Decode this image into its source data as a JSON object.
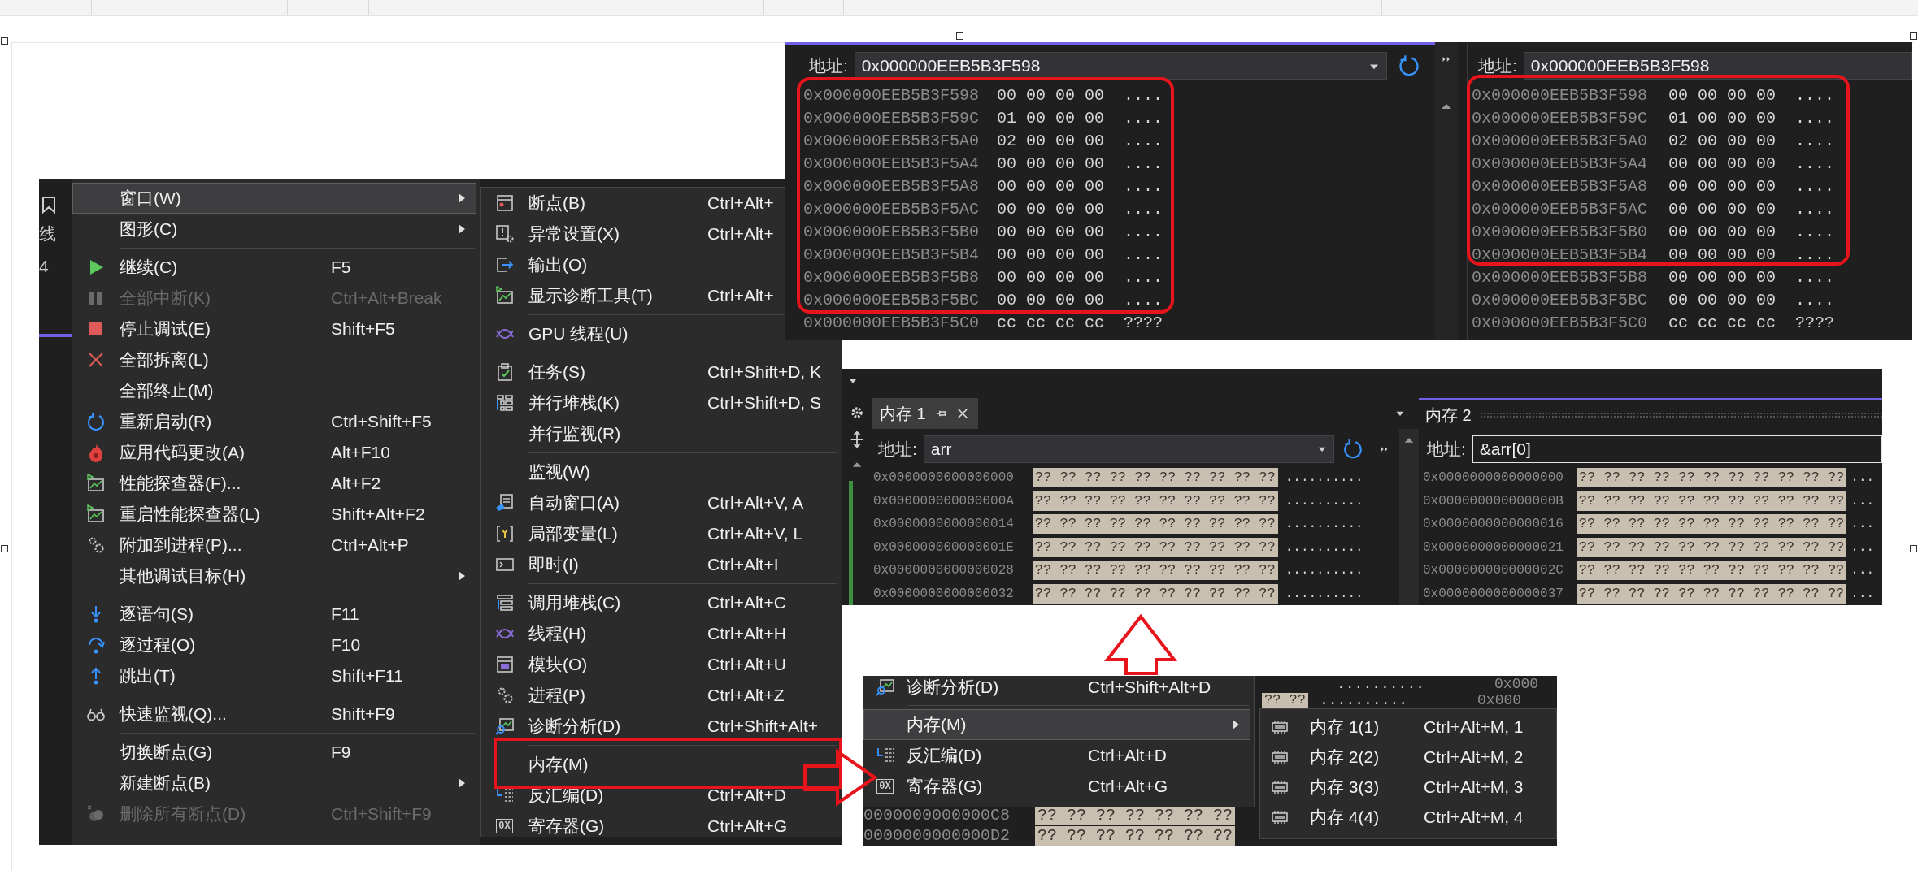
{
  "debug_menu": {
    "ide_edge": [
      "线",
      "4"
    ],
    "items": [
      {
        "kind": "item",
        "label": "窗口(W)",
        "selected": true,
        "disabled": false,
        "submenu": true
      },
      {
        "kind": "item",
        "label": "图形(C)",
        "selected": false,
        "disabled": false,
        "submenu": true
      },
      {
        "kind": "separator"
      },
      {
        "kind": "item",
        "label": "继续(C)",
        "shortcut": "F5",
        "selected": false,
        "disabled": false,
        "submenu": false
      },
      {
        "kind": "item",
        "label": "全部中断(K)",
        "shortcut": "Ctrl+Alt+Break",
        "selected": false,
        "disabled": true,
        "submenu": false
      },
      {
        "kind": "item",
        "label": "停止调试(E)",
        "shortcut": "Shift+F5",
        "selected": false,
        "disabled": false,
        "submenu": false
      },
      {
        "kind": "item",
        "label": "全部拆离(L)",
        "selected": false,
        "disabled": false,
        "submenu": false
      },
      {
        "kind": "item",
        "label": "全部终止(M)",
        "selected": false,
        "disabled": false,
        "submenu": false
      },
      {
        "kind": "item",
        "label": "重新启动(R)",
        "shortcut": "Ctrl+Shift+F5",
        "selected": false,
        "disabled": false,
        "submenu": false
      },
      {
        "kind": "item",
        "label": "应用代码更改(A)",
        "shortcut": "Alt+F10",
        "selected": false,
        "disabled": false,
        "submenu": false
      },
      {
        "kind": "item",
        "label": "性能探查器(F)...",
        "shortcut": "Alt+F2",
        "selected": false,
        "disabled": false,
        "submenu": false
      },
      {
        "kind": "item",
        "label": "重启性能探查器(L)",
        "shortcut": "Shift+Alt+F2",
        "selected": false,
        "disabled": false,
        "submenu": false
      },
      {
        "kind": "item",
        "label": "附加到进程(P)...",
        "shortcut": "Ctrl+Alt+P",
        "selected": false,
        "disabled": false,
        "submenu": false
      },
      {
        "kind": "item",
        "label": "其他调试目标(H)",
        "selected": false,
        "disabled": false,
        "submenu": true
      },
      {
        "kind": "separator"
      },
      {
        "kind": "item",
        "label": "逐语句(S)",
        "shortcut": "F11",
        "selected": false,
        "disabled": false,
        "submenu": false
      },
      {
        "kind": "item",
        "label": "逐过程(O)",
        "shortcut": "F10",
        "selected": false,
        "disabled": false,
        "submenu": false
      },
      {
        "kind": "item",
        "label": "跳出(T)",
        "shortcut": "Shift+F11",
        "selected": false,
        "disabled": false,
        "submenu": false
      },
      {
        "kind": "separator"
      },
      {
        "kind": "item",
        "label": "快速监视(Q)...",
        "shortcut": "Shift+F9",
        "selected": false,
        "disabled": false,
        "submenu": false
      },
      {
        "kind": "separator"
      },
      {
        "kind": "item",
        "label": "切换断点(G)",
        "shortcut": "F9",
        "selected": false,
        "disabled": false,
        "submenu": false
      },
      {
        "kind": "item",
        "label": "新建断点(B)",
        "selected": false,
        "disabled": false,
        "submenu": true
      },
      {
        "kind": "item",
        "label": "删除所有断点(D)",
        "shortcut": "Ctrl+Shift+F9",
        "selected": false,
        "disabled": true,
        "submenu": false
      },
      {
        "kind": "separator"
      }
    ]
  },
  "window_submenu": {
    "items": [
      {
        "kind": "item",
        "label": "断点(B)",
        "shortcut": "Ctrl+Alt+"
      },
      {
        "kind": "item",
        "label": "异常设置(X)",
        "shortcut": "Ctrl+Alt+"
      },
      {
        "kind": "item",
        "label": "输出(O)"
      },
      {
        "kind": "item",
        "label": "显示诊断工具(T)",
        "shortcut": "Ctrl+Alt+"
      },
      {
        "kind": "separator"
      },
      {
        "kind": "item",
        "label": "GPU 线程(U)"
      },
      {
        "kind": "separator"
      },
      {
        "kind": "item",
        "label": "任务(S)",
        "shortcut": "Ctrl+Shift+D, K"
      },
      {
        "kind": "item",
        "label": "并行堆栈(K)",
        "shortcut": "Ctrl+Shift+D, S"
      },
      {
        "kind": "item",
        "label": "并行监视(R)"
      },
      {
        "kind": "separator"
      },
      {
        "kind": "item",
        "label": "监视(W)"
      },
      {
        "kind": "item",
        "label": "自动窗口(A)",
        "shortcut": "Ctrl+Alt+V, A"
      },
      {
        "kind": "item",
        "label": "局部变量(L)",
        "shortcut": "Ctrl+Alt+V, L"
      },
      {
        "kind": "item",
        "label": "即时(I)",
        "shortcut": "Ctrl+Alt+I"
      },
      {
        "kind": "separator"
      },
      {
        "kind": "item",
        "label": "调用堆栈(C)",
        "shortcut": "Ctrl+Alt+C"
      },
      {
        "kind": "item",
        "label": "线程(H)",
        "shortcut": "Ctrl+Alt+H"
      },
      {
        "kind": "item",
        "label": "模块(O)",
        "shortcut": "Ctrl+Alt+U"
      },
      {
        "kind": "item",
        "label": "进程(P)",
        "shortcut": "Ctrl+Alt+Z"
      },
      {
        "kind": "item",
        "label": "诊断分析(D)",
        "shortcut": "Ctrl+Shift+Alt+"
      },
      {
        "kind": "separator"
      },
      {
        "kind": "item",
        "label": "内存(M)"
      },
      {
        "kind": "item",
        "label": "反汇编(D)",
        "shortcut": "Ctrl+Alt+D"
      },
      {
        "kind": "item",
        "label": "寄存器(G)",
        "shortcut": "Ctrl+Alt+G",
        "badge": "0X"
      }
    ]
  },
  "memory_window_top": {
    "panes": [
      {
        "active": true,
        "address_label": "地址:",
        "address": "0x000000EEB5B3F598",
        "rows": [
          {
            "address": "0x000000EEB5B3F598",
            "bytes": "00 00 00 00",
            "chars": "...."
          },
          {
            "address": "0x000000EEB5B3F59C",
            "bytes": "01 00 00 00",
            "chars": "...."
          },
          {
            "address": "0x000000EEB5B3F5A0",
            "bytes": "02 00 00 00",
            "chars": "...."
          },
          {
            "address": "0x000000EEB5B3F5A4",
            "bytes": "00 00 00 00",
            "chars": "...."
          },
          {
            "address": "0x000000EEB5B3F5A8",
            "bytes": "00 00 00 00",
            "chars": "...."
          },
          {
            "address": "0x000000EEB5B3F5AC",
            "bytes": "00 00 00 00",
            "chars": "...."
          },
          {
            "address": "0x000000EEB5B3F5B0",
            "bytes": "00 00 00 00",
            "chars": "...."
          },
          {
            "address": "0x000000EEB5B3F5B4",
            "bytes": "00 00 00 00",
            "chars": "...."
          },
          {
            "address": "0x000000EEB5B3F5B8",
            "bytes": "00 00 00 00",
            "chars": "...."
          },
          {
            "address": "0x000000EEB5B3F5BC",
            "bytes": "00 00 00 00",
            "chars": "...."
          },
          {
            "address": "0x000000EEB5B3F5C0",
            "bytes": "cc cc cc cc",
            "chars": "????"
          }
        ]
      },
      {
        "active": false,
        "address_label": "地址:",
        "address": "0x000000EEB5B3F598",
        "rows": [
          {
            "address": "0x000000EEB5B3F598",
            "bytes": "00 00 00 00",
            "chars": "...."
          },
          {
            "address": "0x000000EEB5B3F59C",
            "bytes": "01 00 00 00",
            "chars": "...."
          },
          {
            "address": "0x000000EEB5B3F5A0",
            "bytes": "02 00 00 00",
            "chars": "...."
          },
          {
            "address": "0x000000EEB5B3F5A4",
            "bytes": "00 00 00 00",
            "chars": "...."
          },
          {
            "address": "0x000000EEB5B3F5A8",
            "bytes": "00 00 00 00",
            "chars": "...."
          },
          {
            "address": "0x000000EEB5B3F5AC",
            "bytes": "00 00 00 00",
            "chars": "...."
          },
          {
            "address": "0x000000EEB5B3F5B0",
            "bytes": "00 00 00 00",
            "chars": "...."
          },
          {
            "address": "0x000000EEB5B3F5B4",
            "bytes": "00 00 00 00",
            "chars": "...."
          },
          {
            "address": "0x000000EEB5B3F5B8",
            "bytes": "00 00 00 00",
            "chars": "...."
          },
          {
            "address": "0x000000EEB5B3F5BC",
            "bytes": "00 00 00 00",
            "chars": "...."
          },
          {
            "address": "0x000000EEB5B3F5C0",
            "bytes": "cc cc cc cc",
            "chars": "????"
          }
        ]
      }
    ]
  },
  "memory_window_bottom": {
    "panes": [
      {
        "title": "内存 1",
        "active": false,
        "address_label": "地址:",
        "address": "arr",
        "rows": [
          {
            "address": "0x0000000000000000",
            "bytes": "?? ?? ?? ?? ?? ?? ?? ?? ?? ??",
            "chars": ".........."
          },
          {
            "address": "0x000000000000000A",
            "bytes": "?? ?? ?? ?? ?? ?? ?? ?? ?? ??",
            "chars": ".........."
          },
          {
            "address": "0x0000000000000014",
            "bytes": "?? ?? ?? ?? ?? ?? ?? ?? ?? ??",
            "chars": ".........."
          },
          {
            "address": "0x000000000000001E",
            "bytes": "?? ?? ?? ?? ?? ?? ?? ?? ?? ??",
            "chars": ".........."
          },
          {
            "address": "0x0000000000000028",
            "bytes": "?? ?? ?? ?? ?? ?? ?? ?? ?? ??",
            "chars": ".........."
          },
          {
            "address": "0x0000000000000032",
            "bytes": "?? ?? ?? ?? ?? ?? ?? ?? ?? ??",
            "chars": ".........."
          }
        ]
      },
      {
        "title": "内存 2",
        "active": true,
        "address_label": "地址:",
        "address": "&arr[0]",
        "rows": [
          {
            "address": "0x0000000000000000",
            "bytes": "?? ?? ?? ?? ?? ?? ?? ?? ?? ?? ??",
            "chars": "..."
          },
          {
            "address": "0x000000000000000B",
            "bytes": "?? ?? ?? ?? ?? ?? ?? ?? ?? ?? ??",
            "chars": "..."
          },
          {
            "address": "0x0000000000000016",
            "bytes": "?? ?? ?? ?? ?? ?? ?? ?? ?? ?? ??",
            "chars": "..."
          },
          {
            "address": "0x0000000000000021",
            "bytes": "?? ?? ?? ?? ?? ?? ?? ?? ?? ?? ??",
            "chars": "..."
          },
          {
            "address": "0x000000000000002C",
            "bytes": "?? ?? ?? ?? ?? ?? ?? ?? ?? ?? ??",
            "chars": "..."
          },
          {
            "address": "0x0000000000000037",
            "bytes": "?? ?? ?? ?? ?? ?? ?? ?? ?? ?? ??",
            "chars": "..."
          }
        ]
      }
    ]
  },
  "menu_crop": {
    "background_top": [
      {
        "chars": "..........",
        "address": "0x000"
      },
      {
        "bytes": "?? ??",
        "chars": "..........",
        "address": "0x000"
      }
    ],
    "items": [
      {
        "kind": "item",
        "label": "诊断分析(D)",
        "shortcut": "Ctrl+Shift+Alt+D",
        "selected": false,
        "submenu": false
      },
      {
        "kind": "separator"
      },
      {
        "kind": "item",
        "label": "内存(M)",
        "selected": true,
        "submenu": true
      },
      {
        "kind": "item",
        "label": "反汇编(D)",
        "shortcut": "Ctrl+Alt+D",
        "selected": false,
        "submenu": false
      },
      {
        "kind": "item",
        "label": "寄存器(G)",
        "shortcut": "Ctrl+Alt+G",
        "selected": false,
        "submenu": false,
        "badge": "0X"
      }
    ],
    "submenu": {
      "items": [
        {
          "kind": "item",
          "label": "内存 1(1)",
          "shortcut": "Ctrl+Alt+M, 1"
        },
        {
          "kind": "item",
          "label": "内存 2(2)",
          "shortcut": "Ctrl+Alt+M, 2"
        },
        {
          "kind": "item",
          "label": "内存 3(3)",
          "shortcut": "Ctrl+Alt+M, 3"
        },
        {
          "kind": "item",
          "label": "内存 4(4)",
          "shortcut": "Ctrl+Alt+M, 4"
        }
      ]
    },
    "background_rows": [
      {
        "address": "0000000000000C8",
        "bytes": "?? ?? ?? ?? ?? ?? ??"
      },
      {
        "address": "0000000000000D2",
        "bytes": "?? ?? ?? ?? ?? ?? ??"
      }
    ]
  }
}
